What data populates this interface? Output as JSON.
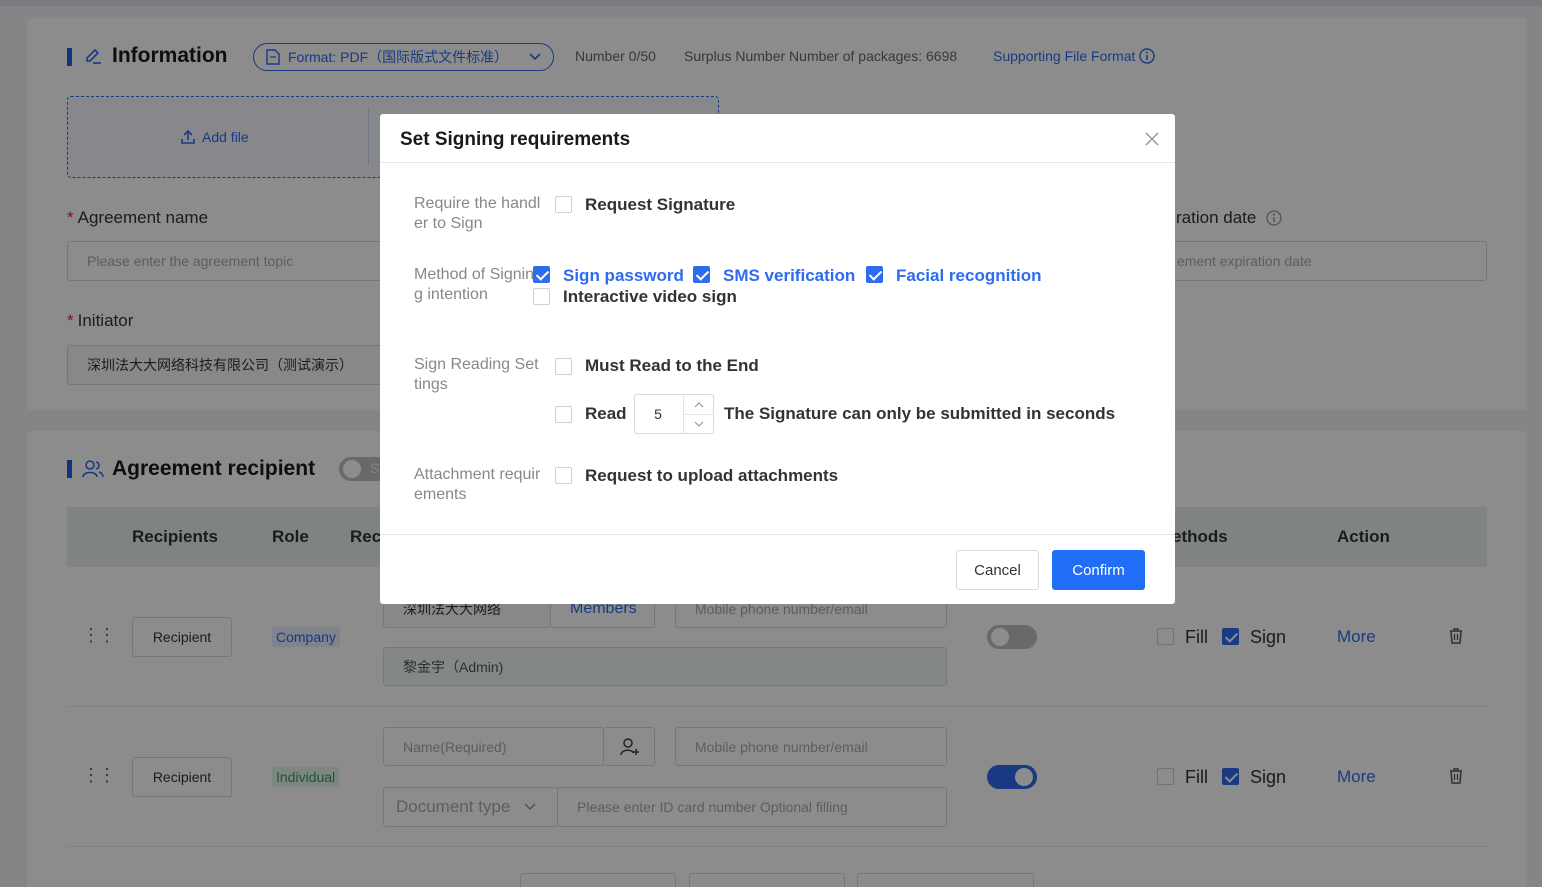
{
  "info": {
    "title": "Information",
    "format_label": "Format: PDF（国际版式文件标准）",
    "number_text": "Number 0/50",
    "surplus_text": "Surplus Number Number of packages: 6698",
    "supporting_link": "Supporting File Format",
    "add_file": "Add file",
    "agreement_name_label": "Agreement name",
    "agreement_name_placeholder": "Please enter the agreement topic",
    "expiration_label": "ration date",
    "expiration_placeholder": "ement expiration date",
    "initiator_label": "Initiator",
    "initiator_value": "深圳法大大网络科技有限公司（测试演示）"
  },
  "recipient_section": {
    "title": "Agreement recipient",
    "toggle_partial": "S",
    "columns": {
      "recipients": "Recipients",
      "role": "Role",
      "reci": "Reci",
      "methods": "ethods",
      "action": "Action"
    },
    "rows": [
      {
        "button": "Recipient",
        "role": "Company",
        "company_partial": "深圳法大大网络",
        "members": "Members",
        "contact_placeholder": "Mobile phone number/email",
        "admin": "黎金宇（Admin)",
        "toggle_on": false,
        "fill": "Fill",
        "sign": "Sign",
        "more": "More"
      },
      {
        "button": "Recipient",
        "role": "Individual",
        "name_placeholder": "Name(Required)",
        "contact_placeholder": "Mobile phone number/email",
        "doc_type": "Document type",
        "id_placeholder": "Please enter ID card number Optional filling",
        "toggle_on": true,
        "fill": "Fill",
        "sign": "Sign",
        "more": "More"
      }
    ]
  },
  "modal": {
    "title": "Set Signing requirements",
    "sections": {
      "handler_label": "Require the handler to Sign",
      "request_signature": "Request Signature",
      "method_label": "Method of Signing intention",
      "sign_password": "Sign password",
      "sms_verification": "SMS verification",
      "facial_recognition": "Facial recognition",
      "interactive_video": "Interactive video sign",
      "reading_label": "Sign Reading Settings",
      "must_read": "Must Read to the End",
      "read": "Read",
      "read_seconds": "5",
      "read_suffix": "The Signature can only be submitted in seconds",
      "attachment_label": "Attachment requirements",
      "upload_attachments": "Request to upload attachments"
    },
    "cancel": "Cancel",
    "confirm": "Confirm"
  },
  "colors": {
    "accent": "#2f6bef",
    "confirm": "#1f6ef5",
    "overlay": "rgba(0,0,0,0.45)"
  }
}
